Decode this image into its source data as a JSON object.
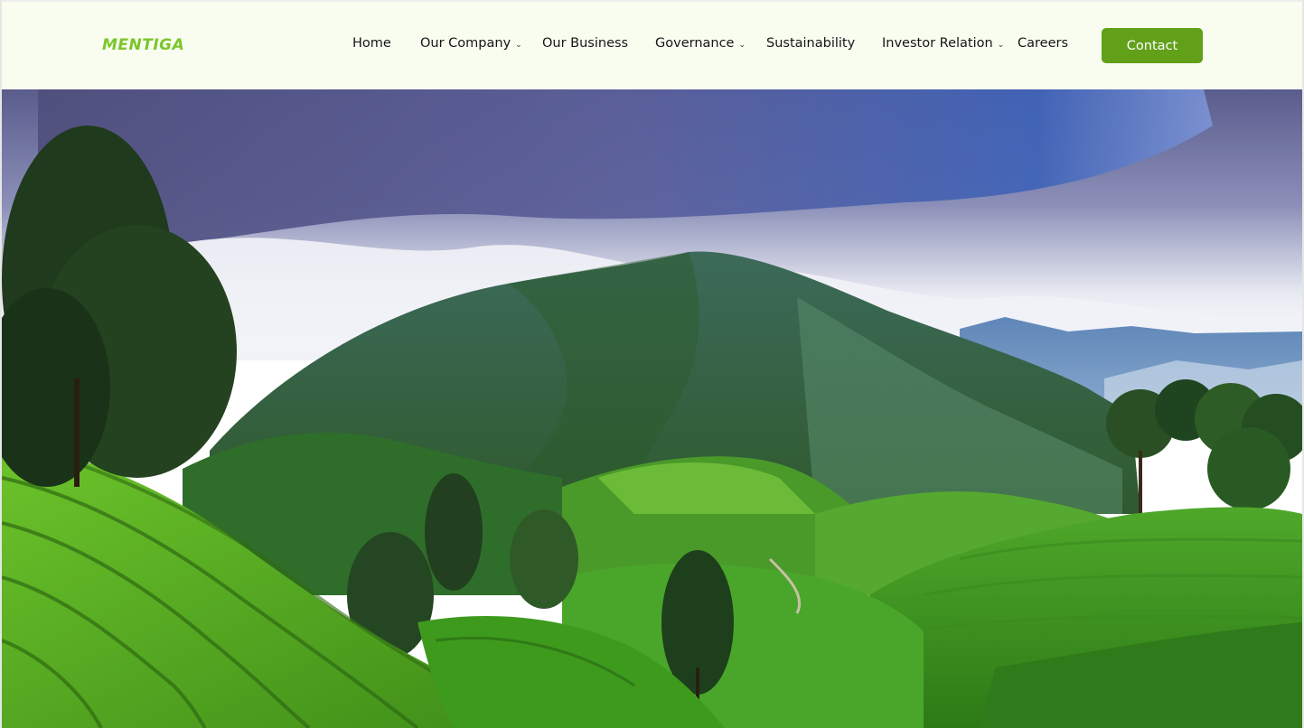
{
  "brand": {
    "logo_text": "MENTIGA"
  },
  "nav": {
    "items": [
      {
        "label": "Home",
        "has_dropdown": false
      },
      {
        "label": "Our Company",
        "has_dropdown": true
      },
      {
        "label": "Our Business",
        "has_dropdown": false
      },
      {
        "label": "Governance",
        "has_dropdown": true
      },
      {
        "label": "Sustainability",
        "has_dropdown": false
      },
      {
        "label": "Investor Relation",
        "has_dropdown": true
      },
      {
        "label": "Careers",
        "has_dropdown": false
      }
    ],
    "dropdown_glyph": "⌄",
    "contact_label": "Contact"
  },
  "hero": {
    "image_icon": "landscape-photo",
    "description_visible": false
  },
  "colors": {
    "header_bg": "#f8fdf0",
    "logo": "#7bc62b",
    "accent_button": "#62a01a",
    "nav_text": "#161616"
  }
}
